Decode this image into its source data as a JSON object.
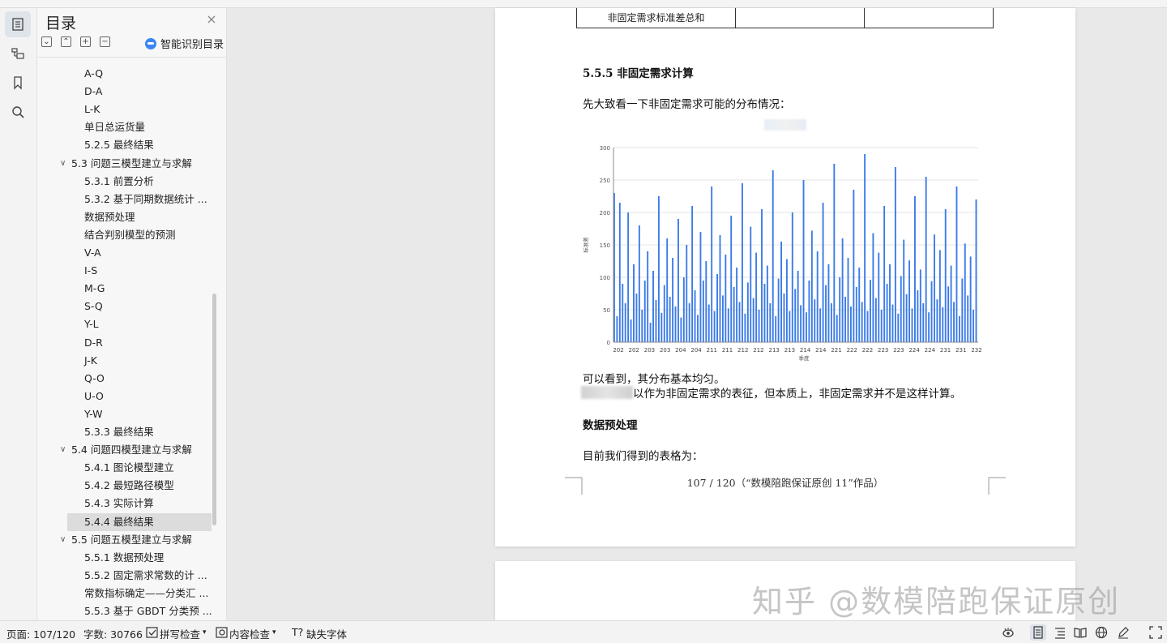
{
  "sidebar": {
    "title": "目录",
    "close": "×",
    "smart_toc_label": "智能识别目录",
    "tools": [
      "⌄",
      "⌃",
      "+",
      "−"
    ],
    "items": [
      {
        "label": "A-Q",
        "level": 3
      },
      {
        "label": "D-A",
        "level": 3
      },
      {
        "label": "L-K",
        "level": 3
      },
      {
        "label": "单日总运货量",
        "level": 3
      },
      {
        "label": "5.2.5  最终结果",
        "level": 3
      },
      {
        "label": "5.3 问题三模型建立与求解",
        "level": 2,
        "chevron": "∨"
      },
      {
        "label": "5.3.1  前置分析",
        "level": 3
      },
      {
        "label": "5.3.2  基于同期数据统计 ...",
        "level": 3
      },
      {
        "label": "数据预处理",
        "level": 3
      },
      {
        "label": "结合判别模型的预测",
        "level": 3
      },
      {
        "label": "V-A",
        "level": 3
      },
      {
        "label": "I-S",
        "level": 3
      },
      {
        "label": "M-G",
        "level": 3
      },
      {
        "label": "S-Q",
        "level": 3
      },
      {
        "label": "Y-L",
        "level": 3
      },
      {
        "label": "D-R",
        "level": 3
      },
      {
        "label": "J-K",
        "level": 3
      },
      {
        "label": "Q-O",
        "level": 3
      },
      {
        "label": "U-O",
        "level": 3
      },
      {
        "label": "Y-W",
        "level": 3
      },
      {
        "label": "5.3.3 最终结果",
        "level": 3
      },
      {
        "label": "5.4  问题四模型建立与求解",
        "level": 2,
        "chevron": "∨"
      },
      {
        "label": "5.4.1  图论模型建立",
        "level": 3
      },
      {
        "label": "5.4.2  最短路径模型",
        "level": 3
      },
      {
        "label": "5.4.3  实际计算",
        "level": 3
      },
      {
        "label": "5.4.4  最终结果",
        "level": 3,
        "selected": true
      },
      {
        "label": "5.5  问题五模型建立与求解",
        "level": 2,
        "chevron": "∨"
      },
      {
        "label": "5.5.1  数据预处理",
        "level": 3
      },
      {
        "label": "5.5.2  固定需求常数的计 ...",
        "level": 3
      },
      {
        "label": "常数指标确定——分类汇 ...",
        "level": 3
      },
      {
        "label": "5.5.3  基于 GBDT 分类预 ...",
        "level": 3
      }
    ]
  },
  "document": {
    "table_cell": "非固定需求标准差总和",
    "heading": "5.5.5 非固定需求计算",
    "para1": "先大致看一下非固定需求可能的分布情况：",
    "para2": "可以看到，其分布基本均匀。",
    "para3": "以作为非固定需求的表征，但本质上，非固定需求并不是这样计算。",
    "heading2": "数据预处理",
    "para4": "目前我们得到的表格为：",
    "footer": "107 / 120（“数模陪跑保证原创 11”作品）"
  },
  "chart_data": {
    "type": "bar",
    "ylabel": "标准差",
    "xlabel": "季度",
    "ylim": [
      0,
      300
    ],
    "yticks": [
      0,
      50,
      100,
      150,
      200,
      250,
      300
    ],
    "xtick_labels": [
      "202",
      "202",
      "203",
      "203",
      "204",
      "204",
      "211",
      "211",
      "212",
      "212",
      "213",
      "213",
      "214",
      "214",
      "221",
      "222",
      "222",
      "223",
      "223",
      "224",
      "224",
      "231",
      "231",
      "232"
    ],
    "series_color": "#3b7be8",
    "note": "dense bar series, values mostly between 20 and 230, roughly uniform",
    "values": [
      230,
      40,
      215,
      90,
      60,
      200,
      35,
      120,
      75,
      180,
      50,
      95,
      140,
      30,
      110,
      65,
      225,
      45,
      88,
      160,
      70,
      130,
      55,
      190,
      38,
      100,
      150,
      60,
      210,
      80,
      42,
      170,
      95,
      125,
      58,
      240,
      48,
      105,
      165,
      72,
      135,
      52,
      195,
      85,
      115,
      62,
      245,
      44,
      92,
      178,
      68,
      138,
      50,
      205,
      90,
      118,
      60,
      265,
      40,
      98,
      155,
      75,
      128,
      48,
      200,
      82,
      110,
      57,
      250,
      46,
      95,
      172,
      66,
      140,
      52,
      215,
      88,
      120,
      60,
      275,
      42,
      100,
      160,
      70,
      130,
      55,
      235,
      85,
      115,
      62,
      290,
      48,
      96,
      168,
      68,
      138,
      50,
      210,
      90,
      120,
      58,
      270,
      44,
      102,
      158,
      74,
      126,
      52,
      225,
      80,
      112,
      60,
      255,
      46,
      94,
      166,
      66,
      142,
      54,
      205,
      86,
      118,
      62,
      240,
      40,
      98,
      152,
      72,
      132,
      50,
      220
    ]
  },
  "watermark": "知乎 @数模陪跑保证原创",
  "status_bar": {
    "page": "页面: 107/120",
    "words": "字数: 30766",
    "spell_check": "拼写检查",
    "content_check": "内容检查",
    "missing_font": "缺失字体"
  }
}
